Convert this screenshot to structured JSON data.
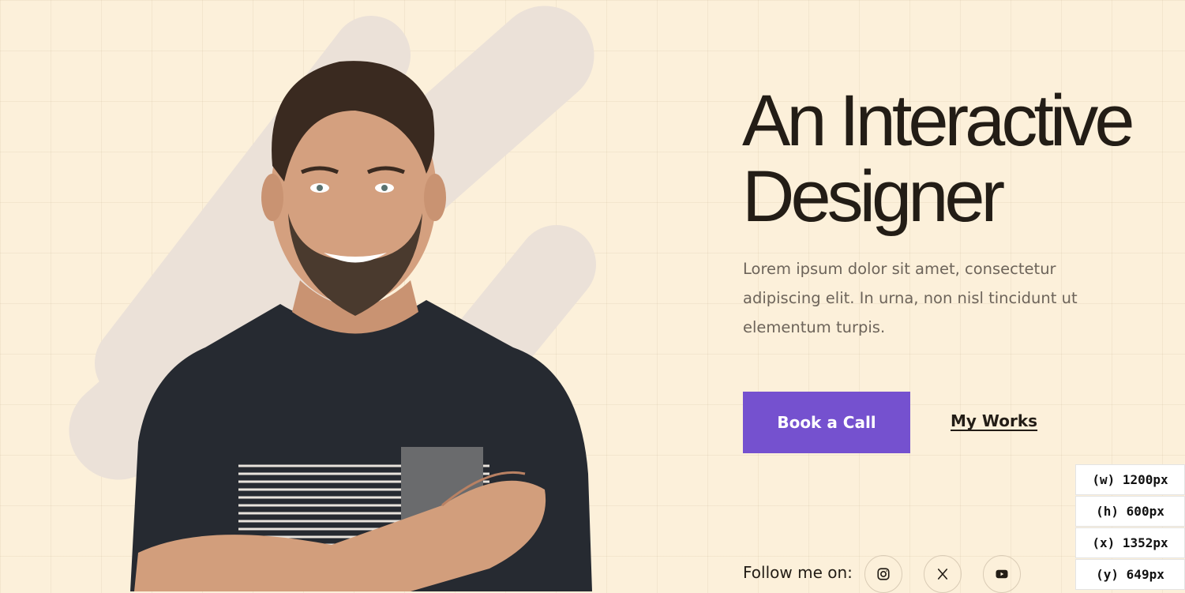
{
  "hero": {
    "headline_line1": "An Interactive",
    "headline_line2": "Designer",
    "intro": "Lorem ipsum dolor sit amet, consectetur adipiscing elit. In urna, non nisl tincidunt ut elementum turpis.",
    "photo_alt": "Smiling man with arms crossed"
  },
  "actions": {
    "book_label": "Book a Call",
    "works_label": "My Works"
  },
  "social": {
    "label": "Follow me on:",
    "icons": [
      "instagram-icon",
      "x-icon",
      "youtube-icon"
    ]
  },
  "inspector": {
    "w": "(w) 1200px",
    "h": "(h) 600px",
    "x": "(x) 1352px",
    "y": "(y) 649px"
  },
  "colors": {
    "background": "#fcf0da",
    "accent": "#7551cf",
    "text": "#231d16",
    "muted": "#6d645a",
    "stripes": "#ebe1d8"
  }
}
